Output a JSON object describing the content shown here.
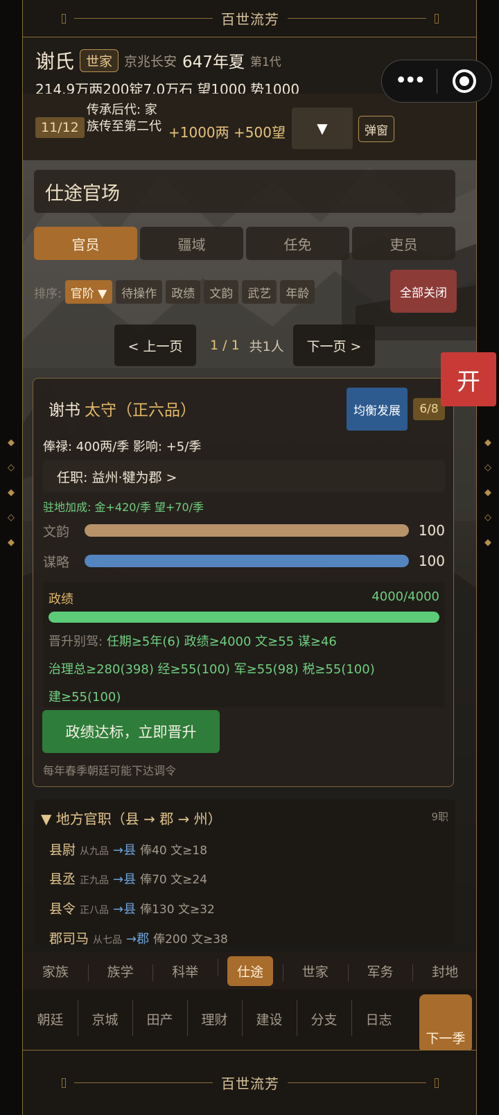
{
  "banner": {
    "top_title": "百世流芳",
    "bottom_title": "百世流芳"
  },
  "header": {
    "clan": "谢氏",
    "tag": "世家",
    "location": "京兆长安",
    "year": "647年夏",
    "generation": "第1代",
    "resources": [
      "214.9万两",
      "200锭",
      "7.0万石",
      "望1000",
      "势1000"
    ]
  },
  "inheritance": {
    "progress": "11/12",
    "description": "传承后代: 家族传至第二代",
    "reward": "+1000两 +500望",
    "dropdown_icon": "▼",
    "popup_label": "弹窗"
  },
  "section_title": "仕途官场",
  "tabs": [
    "官员",
    "疆域",
    "任免",
    "吏员"
  ],
  "sort": {
    "label": "排序:",
    "options": [
      "官阶 ▼",
      "待操作",
      "政绩",
      "文韵",
      "武艺",
      "年龄"
    ],
    "close_all": "全部关闭"
  },
  "pager": {
    "prev": "< 上一页",
    "page": "1 / 1",
    "count": "共1人",
    "next": "下一页 >"
  },
  "open_button": "开",
  "official": {
    "name": "谢书",
    "rank": "太守（正六品）",
    "style": "均衡发展",
    "slots": "6/8",
    "salary": "俸禄: 400两/季   影响: +5/季",
    "post": "任职: 益州·犍为郡  >",
    "bonus": "驻地加成: 金+420/季  望+70/季",
    "stats": [
      {
        "label": "文韵",
        "value": "100",
        "fraction": 1.0,
        "color": "#b8936a"
      },
      {
        "label": "谋略",
        "value": "100",
        "fraction": 1.0,
        "color": "#5585bf"
      }
    ],
    "merit": {
      "label": "政绩",
      "value": "4000/4000",
      "fraction": 1.0,
      "req_label": "晋升别驾:",
      "req_line1": "任期≥5年(6)  政绩≥4000  文≥55  谋≥46",
      "req_line2": "治理总≥280(398)  经≥55(100)  军≥55(98)  税≥55(100)",
      "req_line3": "建≥55(100)"
    },
    "promote_button": "政绩达标，立即晋升",
    "note": "每年春季朝廷可能下达调令"
  },
  "local_list": {
    "heading": "▼ 地方官职（县 → 郡 → 州）",
    "count": "9职",
    "rows": [
      {
        "title": "县尉",
        "grade": "从九品",
        "dest": "→县",
        "stats": "俸40  文≥18"
      },
      {
        "title": "县丞",
        "grade": "正九品",
        "dest": "→县",
        "stats": "俸70  文≥24"
      },
      {
        "title": "县令",
        "grade": "正八品",
        "dest": "→县",
        "stats": "俸130  文≥32"
      },
      {
        "title": "郡司马",
        "grade": "从七品",
        "dest": "→郡",
        "stats": "俸200  文≥38"
      }
    ]
  },
  "nav_primary": [
    "家族",
    "族学",
    "科举",
    "仕途",
    "世家",
    "军务",
    "封地"
  ],
  "nav_secondary": [
    "朝廷",
    "京城",
    "田产",
    "理财",
    "建设",
    "分支",
    "日志"
  ],
  "next_season": "下一季",
  "colors": {
    "accent": "#a86c2c",
    "gold": "#e2b868",
    "green": "#6fcf80",
    "red": "#c93a36",
    "blue": "#2d5a8f"
  }
}
